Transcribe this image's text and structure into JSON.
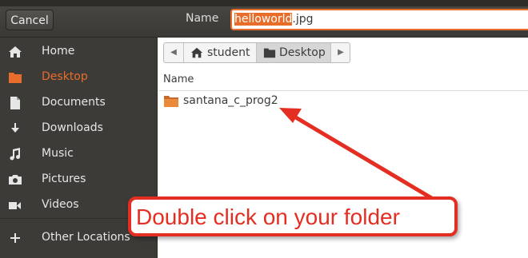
{
  "header": {
    "cancel_label": "Cancel",
    "name_label": "Name",
    "filename_selected": "helloworld",
    "filename_ext": ".jpg"
  },
  "sidebar": {
    "items": [
      {
        "label": "Home",
        "icon": "home-icon",
        "active": false
      },
      {
        "label": "Desktop",
        "icon": "folder-icon",
        "active": true
      },
      {
        "label": "Documents",
        "icon": "document-icon",
        "active": false
      },
      {
        "label": "Downloads",
        "icon": "download-icon",
        "active": false
      },
      {
        "label": "Music",
        "icon": "music-icon",
        "active": false
      },
      {
        "label": "Pictures",
        "icon": "camera-icon",
        "active": false
      },
      {
        "label": "Videos",
        "icon": "video-icon",
        "active": false
      },
      {
        "label": "Other Locations",
        "icon": "plus-icon",
        "active": false
      }
    ]
  },
  "pathbar": {
    "segments": [
      {
        "label": "student",
        "icon": "home-icon"
      },
      {
        "label": "Desktop",
        "icon": "folder-icon",
        "current": true
      }
    ]
  },
  "file_list": {
    "column_header": "Name",
    "items": [
      {
        "name": "santana_c_prog2",
        "icon": "folder-icon"
      }
    ]
  },
  "annotation": {
    "text": "Double click on your folder",
    "color": "#e52e22"
  },
  "colors": {
    "accent": "#e86d2b",
    "sidebar_bg": "#3c3b37"
  }
}
